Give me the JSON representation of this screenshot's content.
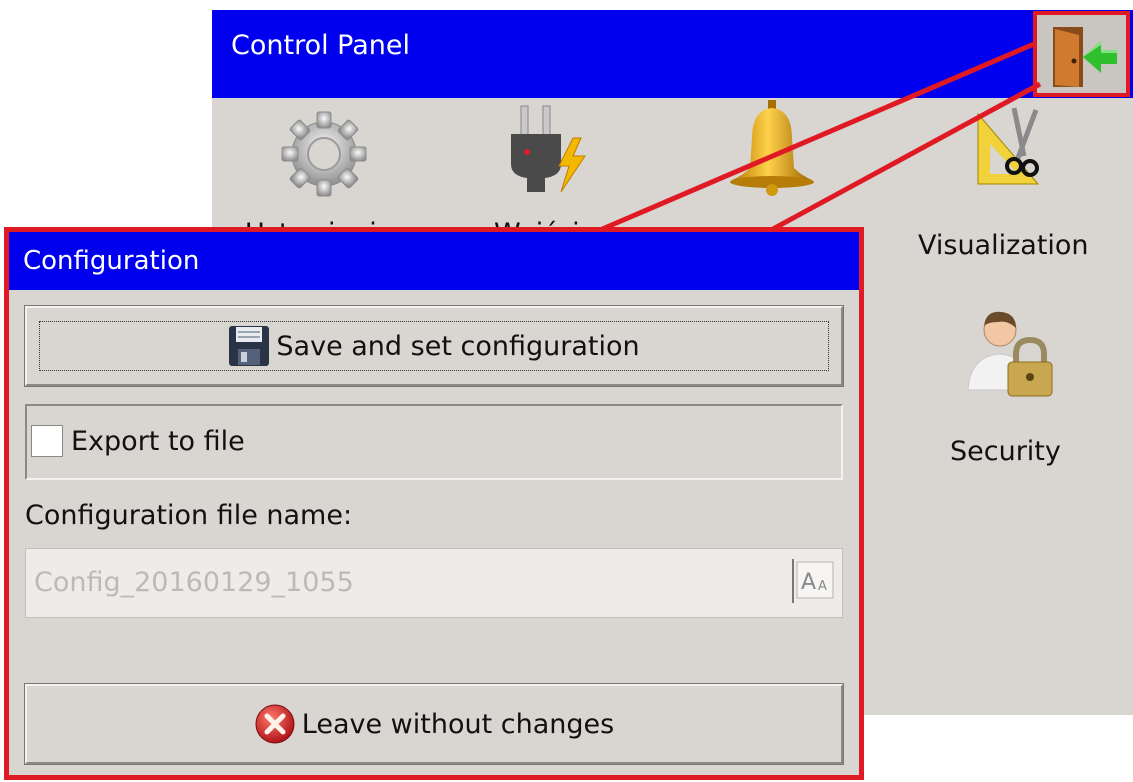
{
  "control_panel": {
    "title": "Control Panel",
    "exit_icon": "door-exit-icon",
    "items": [
      {
        "label": "Ustawienia",
        "icon": "gear-icon"
      },
      {
        "label": "Wejścia",
        "icon": "plug-power-icon"
      },
      {
        "label": "",
        "icon": "bell-icon"
      },
      {
        "label": "Visualization",
        "icon": "ruler-scissors-icon"
      },
      {
        "label": "Security",
        "icon": "user-lock-icon"
      }
    ]
  },
  "configuration": {
    "title": "Configuration",
    "save_button": {
      "label": "Save and set configuration",
      "icon": "floppy-disk-icon"
    },
    "export": {
      "label": "Export to file",
      "checked": false
    },
    "file_name": {
      "label": "Configuration file name:",
      "value": "Config_20160129_1055"
    },
    "keyboard_icon": "keyboard-aa-icon",
    "leave_button": {
      "label": "Leave without changes",
      "icon": "red-x-circle-icon"
    }
  },
  "colors": {
    "titlebar": "#0000ee",
    "panel": "#d9d6d2",
    "highlight": "#e01a24"
  }
}
